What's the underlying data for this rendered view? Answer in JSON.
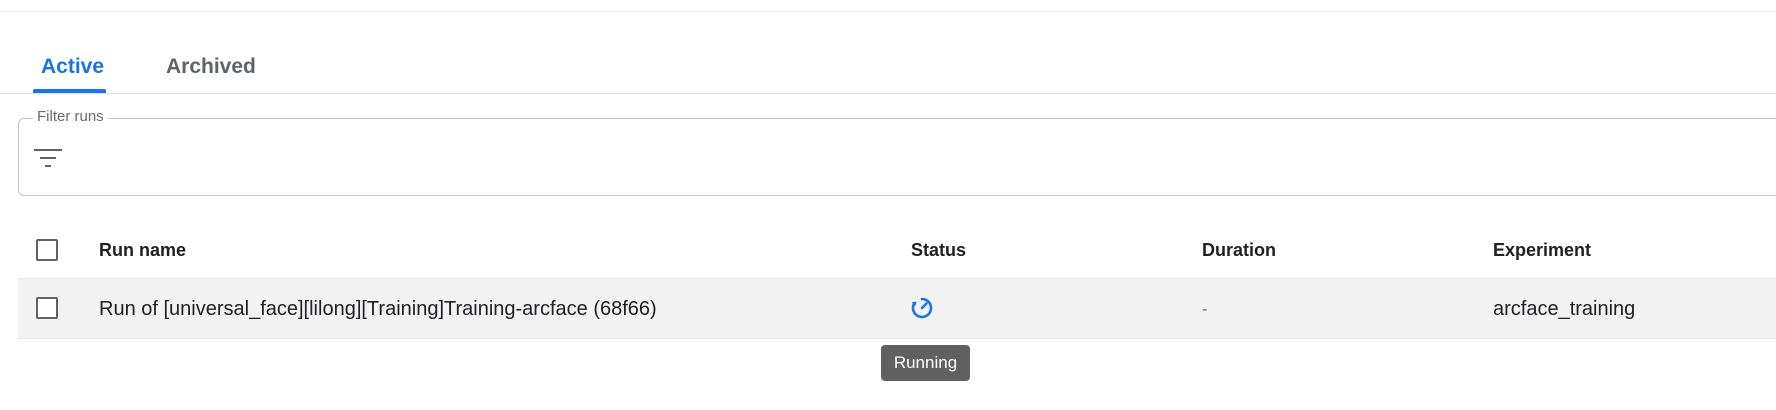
{
  "tabs": [
    {
      "label": "Active",
      "active": true
    },
    {
      "label": "Archived",
      "active": false
    }
  ],
  "filter": {
    "label": "Filter runs",
    "icon": "filter-list-icon"
  },
  "table": {
    "columns": [
      "Run name",
      "Status",
      "Duration",
      "Experiment"
    ],
    "rows": [
      {
        "run_name": "Run of [universal_face][lilong][Training]Training-arcface (68f66)",
        "status_icon": "running-icon",
        "duration": "-",
        "experiment": "arcface_training"
      }
    ]
  },
  "tooltip": {
    "text": "Running"
  },
  "colors": {
    "accent": "#1a73e8",
    "row_bg": "#f2f2f2",
    "tooltip_bg": "#616161"
  }
}
